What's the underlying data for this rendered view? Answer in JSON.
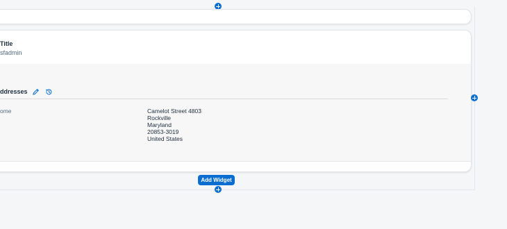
{
  "card": {
    "title": "Title",
    "subtitle": "sfadmin"
  },
  "section": {
    "title": "ddresses",
    "edit_icon": "pencil-icon",
    "history_icon": "history-icon"
  },
  "address": {
    "label": "ome",
    "lines": [
      "Camelot Street 4803",
      "Rockville",
      "Maryland",
      "20853-3019",
      "United States"
    ]
  },
  "actions": {
    "add_widget_label": "Add Widget"
  },
  "colors": {
    "accent": "#0a6ed1",
    "background": "#f5f6f7",
    "card": "#ffffff",
    "section_bg": "#f7f7f7"
  }
}
